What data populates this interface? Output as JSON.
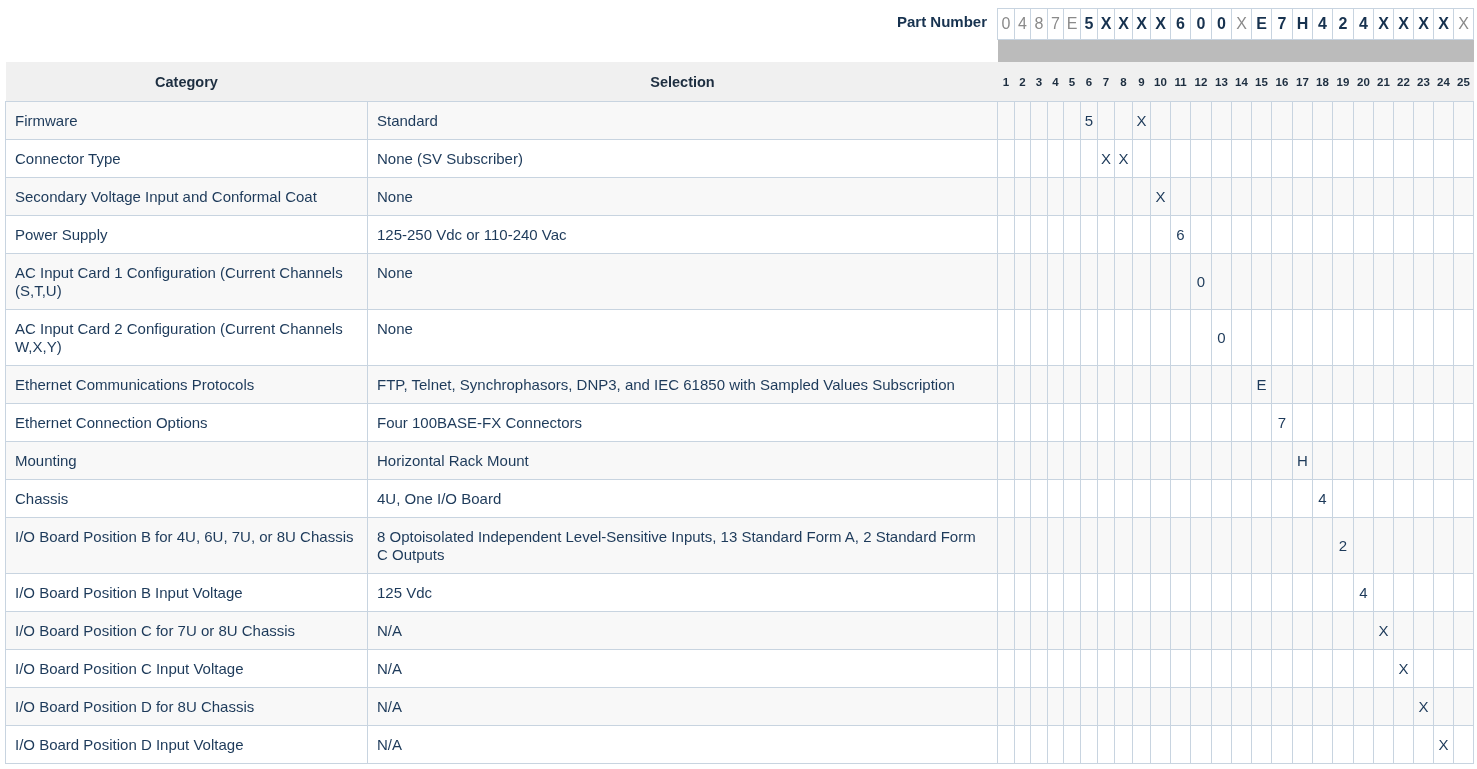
{
  "part_number": {
    "label": "Part Number",
    "chars": [
      {
        "char": "0",
        "kind": "fixed"
      },
      {
        "char": "4",
        "kind": "fixed"
      },
      {
        "char": "8",
        "kind": "fixed"
      },
      {
        "char": "7",
        "kind": "fixed"
      },
      {
        "char": "E",
        "kind": "fixed"
      },
      {
        "char": "5",
        "kind": "option"
      },
      {
        "char": "X",
        "kind": "option"
      },
      {
        "char": "X",
        "kind": "option"
      },
      {
        "char": "X",
        "kind": "option"
      },
      {
        "char": "X",
        "kind": "option"
      },
      {
        "char": "6",
        "kind": "option"
      },
      {
        "char": "0",
        "kind": "option"
      },
      {
        "char": "0",
        "kind": "option"
      },
      {
        "char": "X",
        "kind": "fixed"
      },
      {
        "char": "E",
        "kind": "option"
      },
      {
        "char": "7",
        "kind": "option"
      },
      {
        "char": "H",
        "kind": "option"
      },
      {
        "char": "4",
        "kind": "option"
      },
      {
        "char": "2",
        "kind": "option"
      },
      {
        "char": "4",
        "kind": "option"
      },
      {
        "char": "X",
        "kind": "option"
      },
      {
        "char": "X",
        "kind": "option"
      },
      {
        "char": "X",
        "kind": "option"
      },
      {
        "char": "X",
        "kind": "option"
      },
      {
        "char": "X",
        "kind": "fixed"
      }
    ]
  },
  "table": {
    "columns": [
      "Category",
      "Selection"
    ],
    "positions": [
      "1",
      "2",
      "3",
      "4",
      "5",
      "6",
      "7",
      "8",
      "9",
      "10",
      "11",
      "12",
      "13",
      "14",
      "15",
      "16",
      "17",
      "18",
      "19",
      "20",
      "21",
      "22",
      "23",
      "24",
      "25"
    ],
    "rows": [
      {
        "category": "Firmware",
        "selection": "Standard",
        "codes": [
          {
            "kind": "empty"
          },
          {
            "kind": "empty"
          },
          {
            "kind": "empty"
          },
          {
            "kind": "empty"
          },
          {
            "kind": "empty"
          },
          {
            "kind": "code",
            "text": "5"
          },
          {
            "kind": "empty"
          },
          {
            "kind": "empty"
          },
          {
            "kind": "code",
            "text": "X"
          },
          {
            "kind": "empty"
          },
          {
            "kind": "empty"
          },
          {
            "kind": "empty"
          },
          {
            "kind": "empty"
          },
          {
            "kind": "empty"
          },
          {
            "kind": "empty"
          },
          {
            "kind": "empty"
          },
          {
            "kind": "empty"
          },
          {
            "kind": "empty"
          },
          {
            "kind": "empty"
          },
          {
            "kind": "empty"
          },
          {
            "kind": "empty"
          },
          {
            "kind": "empty"
          },
          {
            "kind": "empty"
          },
          {
            "kind": "empty"
          },
          {
            "kind": "empty"
          }
        ]
      },
      {
        "category": "Connector Type",
        "selection": "None (SV Subscriber)",
        "codes": [
          {
            "kind": "empty"
          },
          {
            "kind": "empty"
          },
          {
            "kind": "empty"
          },
          {
            "kind": "empty"
          },
          {
            "kind": "empty"
          },
          {
            "kind": "empty"
          },
          {
            "kind": "code",
            "text": "X"
          },
          {
            "kind": "code",
            "text": "X"
          },
          {
            "kind": "empty"
          },
          {
            "kind": "empty"
          },
          {
            "kind": "empty"
          },
          {
            "kind": "empty"
          },
          {
            "kind": "empty"
          },
          {
            "kind": "empty"
          },
          {
            "kind": "empty"
          },
          {
            "kind": "empty"
          },
          {
            "kind": "empty"
          },
          {
            "kind": "empty"
          },
          {
            "kind": "empty"
          },
          {
            "kind": "empty"
          },
          {
            "kind": "empty"
          },
          {
            "kind": "empty"
          },
          {
            "kind": "empty"
          },
          {
            "kind": "empty"
          },
          {
            "kind": "empty"
          }
        ]
      },
      {
        "category": "Secondary Voltage Input and Conformal Coat",
        "selection": "None",
        "codes": [
          {
            "kind": "empty"
          },
          {
            "kind": "empty"
          },
          {
            "kind": "empty"
          },
          {
            "kind": "empty"
          },
          {
            "kind": "empty"
          },
          {
            "kind": "empty"
          },
          {
            "kind": "empty"
          },
          {
            "kind": "empty"
          },
          {
            "kind": "empty"
          },
          {
            "kind": "code",
            "text": "X"
          },
          {
            "kind": "empty"
          },
          {
            "kind": "empty"
          },
          {
            "kind": "empty"
          },
          {
            "kind": "empty"
          },
          {
            "kind": "empty"
          },
          {
            "kind": "empty"
          },
          {
            "kind": "empty"
          },
          {
            "kind": "empty"
          },
          {
            "kind": "empty"
          },
          {
            "kind": "empty"
          },
          {
            "kind": "empty"
          },
          {
            "kind": "empty"
          },
          {
            "kind": "empty"
          },
          {
            "kind": "empty"
          },
          {
            "kind": "empty"
          }
        ]
      },
      {
        "category": "Power Supply",
        "selection": "125-250 Vdc or 110-240 Vac",
        "codes": [
          {
            "kind": "empty"
          },
          {
            "kind": "empty"
          },
          {
            "kind": "empty"
          },
          {
            "kind": "empty"
          },
          {
            "kind": "empty"
          },
          {
            "kind": "empty"
          },
          {
            "kind": "empty"
          },
          {
            "kind": "empty"
          },
          {
            "kind": "empty"
          },
          {
            "kind": "empty"
          },
          {
            "kind": "code",
            "text": "6"
          },
          {
            "kind": "empty"
          },
          {
            "kind": "empty"
          },
          {
            "kind": "empty"
          },
          {
            "kind": "empty"
          },
          {
            "kind": "empty"
          },
          {
            "kind": "empty"
          },
          {
            "kind": "empty"
          },
          {
            "kind": "empty"
          },
          {
            "kind": "empty"
          },
          {
            "kind": "empty"
          },
          {
            "kind": "empty"
          },
          {
            "kind": "empty"
          },
          {
            "kind": "empty"
          },
          {
            "kind": "empty"
          }
        ]
      },
      {
        "category": "AC Input Card 1 Configuration (Current Channels (S,T,U)",
        "selection": "None",
        "codes": [
          {
            "kind": "empty"
          },
          {
            "kind": "empty"
          },
          {
            "kind": "empty"
          },
          {
            "kind": "empty"
          },
          {
            "kind": "empty"
          },
          {
            "kind": "empty"
          },
          {
            "kind": "empty"
          },
          {
            "kind": "empty"
          },
          {
            "kind": "empty"
          },
          {
            "kind": "empty"
          },
          {
            "kind": "empty"
          },
          {
            "kind": "code",
            "text": "0"
          },
          {
            "kind": "empty"
          },
          {
            "kind": "empty"
          },
          {
            "kind": "empty"
          },
          {
            "kind": "empty"
          },
          {
            "kind": "empty"
          },
          {
            "kind": "empty"
          },
          {
            "kind": "empty"
          },
          {
            "kind": "empty"
          },
          {
            "kind": "empty"
          },
          {
            "kind": "empty"
          },
          {
            "kind": "empty"
          },
          {
            "kind": "empty"
          },
          {
            "kind": "empty"
          }
        ]
      },
      {
        "category": "AC Input Card 2 Configuration (Current Channels W,X,Y)",
        "selection": "None",
        "codes": [
          {
            "kind": "empty"
          },
          {
            "kind": "empty"
          },
          {
            "kind": "empty"
          },
          {
            "kind": "empty"
          },
          {
            "kind": "empty"
          },
          {
            "kind": "empty"
          },
          {
            "kind": "empty"
          },
          {
            "kind": "empty"
          },
          {
            "kind": "empty"
          },
          {
            "kind": "empty"
          },
          {
            "kind": "empty"
          },
          {
            "kind": "empty"
          },
          {
            "kind": "code",
            "text": "0"
          },
          {
            "kind": "empty"
          },
          {
            "kind": "empty"
          },
          {
            "kind": "empty"
          },
          {
            "kind": "empty"
          },
          {
            "kind": "empty"
          },
          {
            "kind": "empty"
          },
          {
            "kind": "empty"
          },
          {
            "kind": "empty"
          },
          {
            "kind": "empty"
          },
          {
            "kind": "empty"
          },
          {
            "kind": "empty"
          },
          {
            "kind": "empty"
          }
        ]
      },
      {
        "category": "Ethernet Communications Protocols",
        "selection": "FTP, Telnet, Synchrophasors, DNP3, and IEC 61850 with Sampled Values Subscription",
        "codes": [
          {
            "kind": "empty"
          },
          {
            "kind": "empty"
          },
          {
            "kind": "empty"
          },
          {
            "kind": "empty"
          },
          {
            "kind": "empty"
          },
          {
            "kind": "empty"
          },
          {
            "kind": "empty"
          },
          {
            "kind": "empty"
          },
          {
            "kind": "empty"
          },
          {
            "kind": "empty"
          },
          {
            "kind": "empty"
          },
          {
            "kind": "empty"
          },
          {
            "kind": "empty"
          },
          {
            "kind": "empty"
          },
          {
            "kind": "code",
            "text": "E"
          },
          {
            "kind": "empty"
          },
          {
            "kind": "empty"
          },
          {
            "kind": "empty"
          },
          {
            "kind": "empty"
          },
          {
            "kind": "empty"
          },
          {
            "kind": "empty"
          },
          {
            "kind": "empty"
          },
          {
            "kind": "empty"
          },
          {
            "kind": "empty"
          },
          {
            "kind": "empty"
          }
        ]
      },
      {
        "category": "Ethernet Connection Options",
        "selection": "Four 100BASE-FX Connectors",
        "codes": [
          {
            "kind": "empty"
          },
          {
            "kind": "empty"
          },
          {
            "kind": "empty"
          },
          {
            "kind": "empty"
          },
          {
            "kind": "empty"
          },
          {
            "kind": "empty"
          },
          {
            "kind": "empty"
          },
          {
            "kind": "empty"
          },
          {
            "kind": "empty"
          },
          {
            "kind": "empty"
          },
          {
            "kind": "empty"
          },
          {
            "kind": "empty"
          },
          {
            "kind": "empty"
          },
          {
            "kind": "empty"
          },
          {
            "kind": "empty"
          },
          {
            "kind": "code",
            "text": "7"
          },
          {
            "kind": "empty"
          },
          {
            "kind": "empty"
          },
          {
            "kind": "empty"
          },
          {
            "kind": "empty"
          },
          {
            "kind": "empty"
          },
          {
            "kind": "empty"
          },
          {
            "kind": "empty"
          },
          {
            "kind": "empty"
          },
          {
            "kind": "empty"
          }
        ]
      },
      {
        "category": "Mounting",
        "selection": "Horizontal Rack Mount",
        "codes": [
          {
            "kind": "empty"
          },
          {
            "kind": "empty"
          },
          {
            "kind": "empty"
          },
          {
            "kind": "empty"
          },
          {
            "kind": "empty"
          },
          {
            "kind": "empty"
          },
          {
            "kind": "empty"
          },
          {
            "kind": "empty"
          },
          {
            "kind": "empty"
          },
          {
            "kind": "empty"
          },
          {
            "kind": "empty"
          },
          {
            "kind": "empty"
          },
          {
            "kind": "empty"
          },
          {
            "kind": "empty"
          },
          {
            "kind": "empty"
          },
          {
            "kind": "empty"
          },
          {
            "kind": "code",
            "text": "H"
          },
          {
            "kind": "empty"
          },
          {
            "kind": "empty"
          },
          {
            "kind": "empty"
          },
          {
            "kind": "empty"
          },
          {
            "kind": "empty"
          },
          {
            "kind": "empty"
          },
          {
            "kind": "empty"
          },
          {
            "kind": "empty"
          }
        ]
      },
      {
        "category": "Chassis",
        "selection": "4U, One I/O Board",
        "codes": [
          {
            "kind": "empty"
          },
          {
            "kind": "empty"
          },
          {
            "kind": "empty"
          },
          {
            "kind": "empty"
          },
          {
            "kind": "empty"
          },
          {
            "kind": "empty"
          },
          {
            "kind": "empty"
          },
          {
            "kind": "empty"
          },
          {
            "kind": "empty"
          },
          {
            "kind": "empty"
          },
          {
            "kind": "empty"
          },
          {
            "kind": "empty"
          },
          {
            "kind": "empty"
          },
          {
            "kind": "empty"
          },
          {
            "kind": "empty"
          },
          {
            "kind": "empty"
          },
          {
            "kind": "empty"
          },
          {
            "kind": "code",
            "text": "4"
          },
          {
            "kind": "empty"
          },
          {
            "kind": "empty"
          },
          {
            "kind": "empty"
          },
          {
            "kind": "empty"
          },
          {
            "kind": "empty"
          },
          {
            "kind": "empty"
          },
          {
            "kind": "empty"
          }
        ]
      },
      {
        "category": "I/O Board Position B for 4U, 6U, 7U, or 8U Chassis",
        "selection": "8 Optoisolated Independent Level-Sensitive Inputs, 13 Standard Form A, 2 Standard Form C Outputs",
        "codes": [
          {
            "kind": "empty"
          },
          {
            "kind": "empty"
          },
          {
            "kind": "empty"
          },
          {
            "kind": "empty"
          },
          {
            "kind": "empty"
          },
          {
            "kind": "empty"
          },
          {
            "kind": "empty"
          },
          {
            "kind": "empty"
          },
          {
            "kind": "empty"
          },
          {
            "kind": "empty"
          },
          {
            "kind": "empty"
          },
          {
            "kind": "empty"
          },
          {
            "kind": "empty"
          },
          {
            "kind": "empty"
          },
          {
            "kind": "empty"
          },
          {
            "kind": "empty"
          },
          {
            "kind": "empty"
          },
          {
            "kind": "empty"
          },
          {
            "kind": "code",
            "text": "2"
          },
          {
            "kind": "empty"
          },
          {
            "kind": "empty"
          },
          {
            "kind": "empty"
          },
          {
            "kind": "empty"
          },
          {
            "kind": "empty"
          },
          {
            "kind": "empty"
          }
        ]
      },
      {
        "category": "I/O Board Position B Input Voltage",
        "selection": "125 Vdc",
        "codes": [
          {
            "kind": "empty"
          },
          {
            "kind": "empty"
          },
          {
            "kind": "empty"
          },
          {
            "kind": "empty"
          },
          {
            "kind": "empty"
          },
          {
            "kind": "empty"
          },
          {
            "kind": "empty"
          },
          {
            "kind": "empty"
          },
          {
            "kind": "empty"
          },
          {
            "kind": "empty"
          },
          {
            "kind": "empty"
          },
          {
            "kind": "empty"
          },
          {
            "kind": "empty"
          },
          {
            "kind": "empty"
          },
          {
            "kind": "empty"
          },
          {
            "kind": "empty"
          },
          {
            "kind": "empty"
          },
          {
            "kind": "empty"
          },
          {
            "kind": "empty"
          },
          {
            "kind": "code",
            "text": "4"
          },
          {
            "kind": "empty"
          },
          {
            "kind": "empty"
          },
          {
            "kind": "empty"
          },
          {
            "kind": "empty"
          },
          {
            "kind": "empty"
          }
        ]
      },
      {
        "category": "I/O Board Position C for 7U or 8U Chassis",
        "selection": "N/A",
        "codes": [
          {
            "kind": "empty"
          },
          {
            "kind": "empty"
          },
          {
            "kind": "empty"
          },
          {
            "kind": "empty"
          },
          {
            "kind": "empty"
          },
          {
            "kind": "empty"
          },
          {
            "kind": "empty"
          },
          {
            "kind": "empty"
          },
          {
            "kind": "empty"
          },
          {
            "kind": "empty"
          },
          {
            "kind": "empty"
          },
          {
            "kind": "empty"
          },
          {
            "kind": "empty"
          },
          {
            "kind": "empty"
          },
          {
            "kind": "empty"
          },
          {
            "kind": "empty"
          },
          {
            "kind": "empty"
          },
          {
            "kind": "empty"
          },
          {
            "kind": "empty"
          },
          {
            "kind": "empty"
          },
          {
            "kind": "code",
            "text": "X"
          },
          {
            "kind": "empty"
          },
          {
            "kind": "empty"
          },
          {
            "kind": "empty"
          },
          {
            "kind": "empty"
          }
        ]
      },
      {
        "category": "I/O Board Position C Input Voltage",
        "selection": "N/A",
        "codes": [
          {
            "kind": "empty"
          },
          {
            "kind": "empty"
          },
          {
            "kind": "empty"
          },
          {
            "kind": "empty"
          },
          {
            "kind": "empty"
          },
          {
            "kind": "empty"
          },
          {
            "kind": "empty"
          },
          {
            "kind": "empty"
          },
          {
            "kind": "empty"
          },
          {
            "kind": "empty"
          },
          {
            "kind": "empty"
          },
          {
            "kind": "empty"
          },
          {
            "kind": "empty"
          },
          {
            "kind": "empty"
          },
          {
            "kind": "empty"
          },
          {
            "kind": "empty"
          },
          {
            "kind": "empty"
          },
          {
            "kind": "empty"
          },
          {
            "kind": "empty"
          },
          {
            "kind": "empty"
          },
          {
            "kind": "empty"
          },
          {
            "kind": "code",
            "text": "X"
          },
          {
            "kind": "empty"
          },
          {
            "kind": "empty"
          },
          {
            "kind": "empty"
          }
        ]
      },
      {
        "category": "I/O Board Position D for 8U Chassis",
        "selection": "N/A",
        "codes": [
          {
            "kind": "empty"
          },
          {
            "kind": "empty"
          },
          {
            "kind": "empty"
          },
          {
            "kind": "empty"
          },
          {
            "kind": "empty"
          },
          {
            "kind": "empty"
          },
          {
            "kind": "empty"
          },
          {
            "kind": "empty"
          },
          {
            "kind": "empty"
          },
          {
            "kind": "empty"
          },
          {
            "kind": "empty"
          },
          {
            "kind": "empty"
          },
          {
            "kind": "empty"
          },
          {
            "kind": "empty"
          },
          {
            "kind": "empty"
          },
          {
            "kind": "empty"
          },
          {
            "kind": "empty"
          },
          {
            "kind": "empty"
          },
          {
            "kind": "empty"
          },
          {
            "kind": "empty"
          },
          {
            "kind": "empty"
          },
          {
            "kind": "empty"
          },
          {
            "kind": "code",
            "text": "X"
          },
          {
            "kind": "empty"
          },
          {
            "kind": "empty"
          }
        ]
      },
      {
        "category": "I/O Board Position D Input Voltage",
        "selection": "N/A",
        "codes": [
          {
            "kind": "empty"
          },
          {
            "kind": "empty"
          },
          {
            "kind": "empty"
          },
          {
            "kind": "empty"
          },
          {
            "kind": "empty"
          },
          {
            "kind": "empty"
          },
          {
            "kind": "empty"
          },
          {
            "kind": "empty"
          },
          {
            "kind": "empty"
          },
          {
            "kind": "empty"
          },
          {
            "kind": "empty"
          },
          {
            "kind": "empty"
          },
          {
            "kind": "empty"
          },
          {
            "kind": "empty"
          },
          {
            "kind": "empty"
          },
          {
            "kind": "empty"
          },
          {
            "kind": "empty"
          },
          {
            "kind": "empty"
          },
          {
            "kind": "empty"
          },
          {
            "kind": "empty"
          },
          {
            "kind": "empty"
          },
          {
            "kind": "empty"
          },
          {
            "kind": "empty"
          },
          {
            "kind": "code",
            "text": "X"
          },
          {
            "kind": "empty"
          }
        ]
      }
    ]
  }
}
